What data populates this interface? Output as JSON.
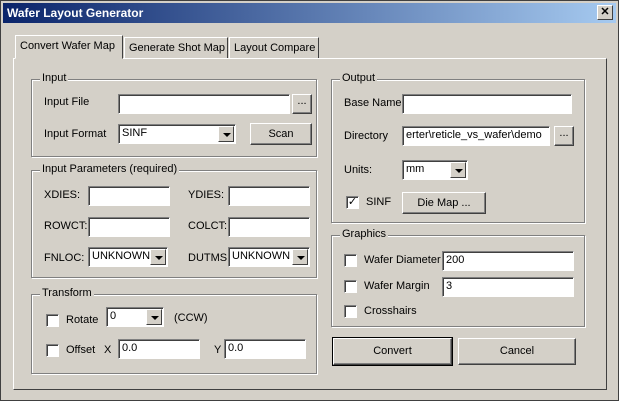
{
  "window": {
    "title": "Wafer Layout Generator",
    "close_glyph": "✕"
  },
  "tabs": [
    "Convert Wafer Map",
    "Generate Shot Map",
    "Layout Compare"
  ],
  "input_group": {
    "legend": "Input",
    "file_label": "Input File",
    "file_value": "",
    "browse_label": "...",
    "format_label": "Input Format",
    "format_value": "SINF",
    "scan_label": "Scan"
  },
  "params_group": {
    "legend": "Input Parameters (required)",
    "xdies_label": "XDIES:",
    "xdies_value": "",
    "ydies_label": "YDIES:",
    "ydies_value": "",
    "rowct_label": "ROWCT:",
    "rowct_value": "",
    "colct_label": "COLCT:",
    "colct_value": "",
    "fnloc_label": "FNLOC:",
    "fnloc_value": "UNKNOWN",
    "dutms_label": "DUTMS:",
    "dutms_value": "UNKNOWN"
  },
  "transform_group": {
    "legend": "Transform",
    "rotate_label": "Rotate",
    "rotate_value": "0",
    "ccw_label": "(CCW)",
    "rotate_checked": false,
    "offset_label": "Offset",
    "offset_checked": false,
    "x_label": "X",
    "x_value": "0.0",
    "y_label": "Y",
    "y_value": "0.0"
  },
  "output_group": {
    "legend": "Output",
    "basename_label": "Base Name",
    "basename_value": "",
    "directory_label": "Directory",
    "directory_value": "erter\\reticle_vs_wafer\\demo",
    "browse_label": "...",
    "units_label": "Units:",
    "units_value": "mm",
    "sinf_label": "SINF",
    "sinf_checked": true,
    "diemap_label": "Die Map ..."
  },
  "graphics_group": {
    "legend": "Graphics",
    "diameter_label": "Wafer Diameter",
    "diameter_value": "200",
    "diameter_checked": false,
    "margin_label": "Wafer Margin",
    "margin_value": "3",
    "margin_checked": false,
    "crosshairs_label": "Crosshairs",
    "crosshairs_checked": false
  },
  "buttons": {
    "convert": "Convert",
    "cancel": "Cancel"
  }
}
